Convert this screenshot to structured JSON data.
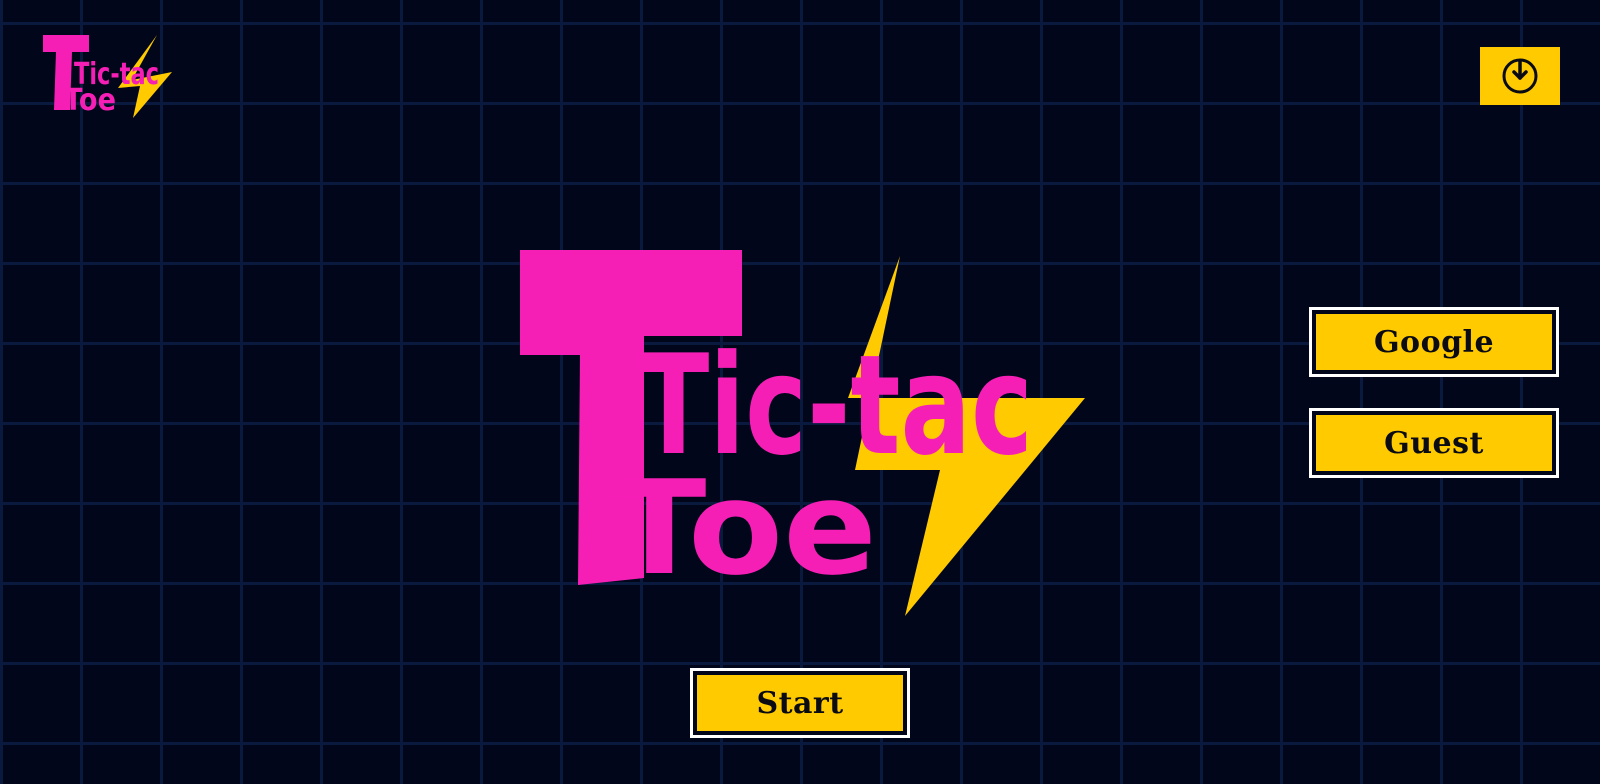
{
  "logo": {
    "line1": "Tic-tac",
    "line2": "Toe",
    "primary_color": "#f61fb6",
    "bolt_color": "#ffcb00"
  },
  "header": {
    "logout_icon": "power-icon"
  },
  "auth": {
    "google_label": "Google",
    "guest_label": "Guest"
  },
  "main": {
    "start_label": "Start"
  },
  "colors": {
    "background": "#02061a",
    "grid": "#0a1a3e",
    "button": "#ffcb00",
    "button_border": "#ffffff"
  }
}
